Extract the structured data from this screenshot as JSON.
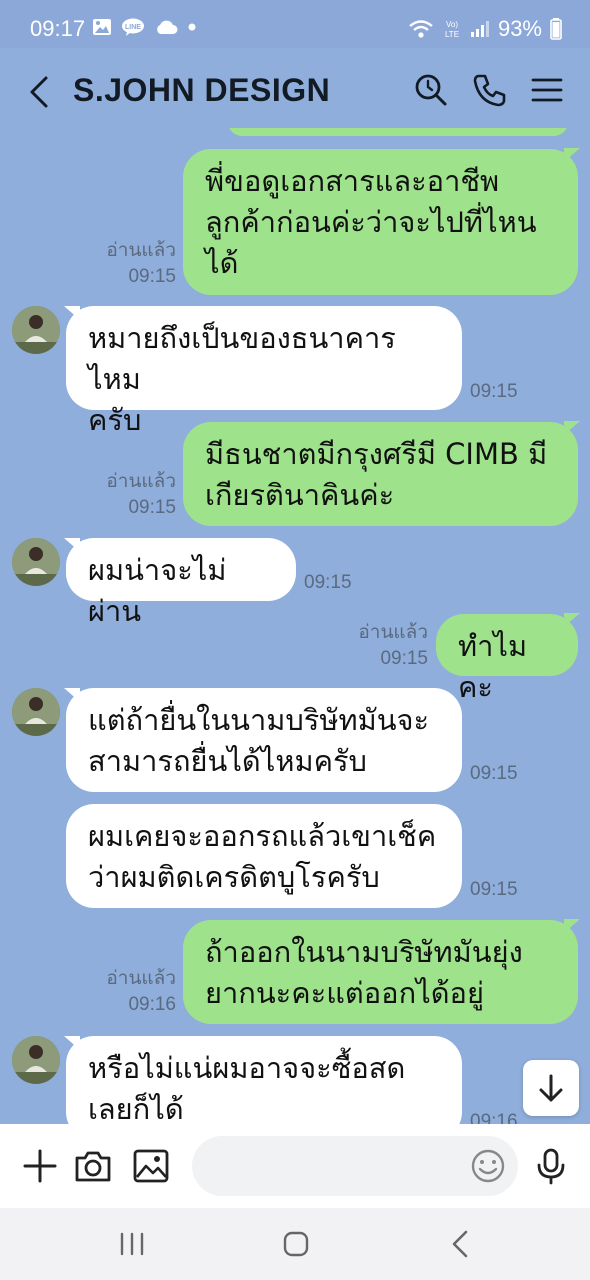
{
  "status_bar": {
    "time": "09:17",
    "signal_label": "Vo) LTE",
    "battery": "93%"
  },
  "header": {
    "title": "S.JOHN DESIGN"
  },
  "messages": [
    {
      "side": "me",
      "lines": [
        "พี่ขอดูเอกสารและอาชีพ",
        "ลูกค้าก่อนค่ะว่าจะไปที่ไหน",
        "ได้"
      ],
      "read": "อ่านแล้ว",
      "time": "09:15"
    },
    {
      "side": "them",
      "lines": [
        "หมายถึงเป็นของธนาคารไหม",
        "ครับ"
      ],
      "time": "09:15"
    },
    {
      "side": "me",
      "lines": [
        "มีธนชาตมีกรุงศรีมี CIMB มี",
        "เกียรตินาคินค่ะ"
      ],
      "read": "อ่านแล้ว",
      "time": "09:15"
    },
    {
      "side": "them",
      "lines": [
        "ผมน่าจะไม่ผ่าน"
      ],
      "time": "09:15"
    },
    {
      "side": "me",
      "lines": [
        "ทำไมคะ"
      ],
      "read": "อ่านแล้ว",
      "time": "09:15"
    },
    {
      "side": "them",
      "lines": [
        "แต่ถ้ายื่นในนามบริษัทมันจะ",
        "สามารถยื่นได้ไหมครับ"
      ],
      "time": "09:15"
    },
    {
      "side": "them",
      "lines": [
        "ผมเคยจะออกรถแล้วเขาเช็ค",
        "ว่าผมติดเครดิตบูโรครับ"
      ],
      "time": "09:15"
    },
    {
      "side": "me",
      "lines": [
        "ถ้าออกในนามบริษัทมันยุ่ง",
        "ยากนะคะแต่ออกได้อยู่"
      ],
      "read": "อ่านแล้ว",
      "time": "09:16"
    },
    {
      "side": "them",
      "lines": [
        "หรือไม่แน่ผมอาจจะซื้อสด",
        "เลยก็ได้"
      ],
      "time": "09:16"
    }
  ],
  "input": {
    "placeholder": ""
  },
  "colors": {
    "chat_bg": "#8faedb",
    "my_bubble": "#9fe28c",
    "their_bubble": "#ffffff",
    "header_text": "#121a24"
  },
  "icons": [
    "back-arrow-icon",
    "search-icon",
    "phone-icon",
    "menu-icon",
    "plus-icon",
    "camera-icon",
    "image-icon",
    "emoji-icon",
    "microphone-icon",
    "arrow-down-icon"
  ]
}
